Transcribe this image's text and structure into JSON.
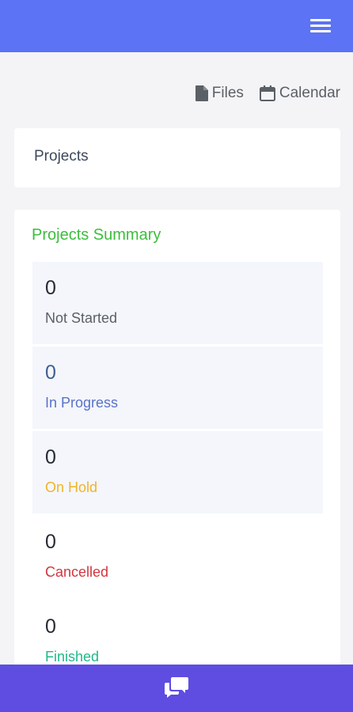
{
  "header": {
    "menu_icon": "hamburger-menu-icon"
  },
  "toolbar": {
    "files": {
      "label": "Files",
      "icon": "file-icon"
    },
    "calendar": {
      "label": "Calendar",
      "icon": "calendar-icon"
    }
  },
  "projects_card": {
    "title": "Projects"
  },
  "summary": {
    "title": "Projects Summary",
    "title_color": "#3cbe3c",
    "items": [
      {
        "count": "0",
        "label": "Not Started",
        "label_color": "#5b5f66",
        "count_color": "#262b33"
      },
      {
        "count": "0",
        "label": "In Progress",
        "label_color": "#5a72c9",
        "count_color": "#3f5f8f"
      },
      {
        "count": "0",
        "label": "On Hold",
        "label_color": "#f0b429",
        "count_color": "#262b33"
      },
      {
        "count": "0",
        "label": "Cancelled",
        "label_color": "#d2363f",
        "count_color": "#262b33"
      },
      {
        "count": "0",
        "label": "Finished",
        "label_color": "#1fb98a",
        "count_color": "#262b33"
      }
    ]
  },
  "footer": {
    "chat_icon": "chat-bubbles-icon"
  },
  "colors": {
    "header_bg": "#5b73f4",
    "footer_bg": "#5e4de0"
  }
}
